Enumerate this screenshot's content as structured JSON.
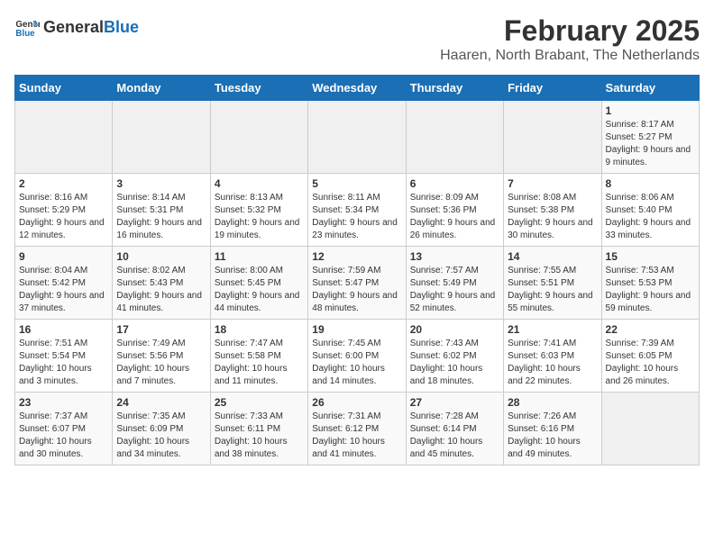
{
  "header": {
    "logo_general": "General",
    "logo_blue": "Blue",
    "month_year": "February 2025",
    "location": "Haaren, North Brabant, The Netherlands"
  },
  "weekdays": [
    "Sunday",
    "Monday",
    "Tuesday",
    "Wednesday",
    "Thursday",
    "Friday",
    "Saturday"
  ],
  "weeks": [
    [
      {
        "day": "",
        "info": ""
      },
      {
        "day": "",
        "info": ""
      },
      {
        "day": "",
        "info": ""
      },
      {
        "day": "",
        "info": ""
      },
      {
        "day": "",
        "info": ""
      },
      {
        "day": "",
        "info": ""
      },
      {
        "day": "1",
        "info": "Sunrise: 8:17 AM\nSunset: 5:27 PM\nDaylight: 9 hours and 9 minutes."
      }
    ],
    [
      {
        "day": "2",
        "info": "Sunrise: 8:16 AM\nSunset: 5:29 PM\nDaylight: 9 hours and 12 minutes."
      },
      {
        "day": "3",
        "info": "Sunrise: 8:14 AM\nSunset: 5:31 PM\nDaylight: 9 hours and 16 minutes."
      },
      {
        "day": "4",
        "info": "Sunrise: 8:13 AM\nSunset: 5:32 PM\nDaylight: 9 hours and 19 minutes."
      },
      {
        "day": "5",
        "info": "Sunrise: 8:11 AM\nSunset: 5:34 PM\nDaylight: 9 hours and 23 minutes."
      },
      {
        "day": "6",
        "info": "Sunrise: 8:09 AM\nSunset: 5:36 PM\nDaylight: 9 hours and 26 minutes."
      },
      {
        "day": "7",
        "info": "Sunrise: 8:08 AM\nSunset: 5:38 PM\nDaylight: 9 hours and 30 minutes."
      },
      {
        "day": "8",
        "info": "Sunrise: 8:06 AM\nSunset: 5:40 PM\nDaylight: 9 hours and 33 minutes."
      }
    ],
    [
      {
        "day": "9",
        "info": "Sunrise: 8:04 AM\nSunset: 5:42 PM\nDaylight: 9 hours and 37 minutes."
      },
      {
        "day": "10",
        "info": "Sunrise: 8:02 AM\nSunset: 5:43 PM\nDaylight: 9 hours and 41 minutes."
      },
      {
        "day": "11",
        "info": "Sunrise: 8:00 AM\nSunset: 5:45 PM\nDaylight: 9 hours and 44 minutes."
      },
      {
        "day": "12",
        "info": "Sunrise: 7:59 AM\nSunset: 5:47 PM\nDaylight: 9 hours and 48 minutes."
      },
      {
        "day": "13",
        "info": "Sunrise: 7:57 AM\nSunset: 5:49 PM\nDaylight: 9 hours and 52 minutes."
      },
      {
        "day": "14",
        "info": "Sunrise: 7:55 AM\nSunset: 5:51 PM\nDaylight: 9 hours and 55 minutes."
      },
      {
        "day": "15",
        "info": "Sunrise: 7:53 AM\nSunset: 5:53 PM\nDaylight: 9 hours and 59 minutes."
      }
    ],
    [
      {
        "day": "16",
        "info": "Sunrise: 7:51 AM\nSunset: 5:54 PM\nDaylight: 10 hours and 3 minutes."
      },
      {
        "day": "17",
        "info": "Sunrise: 7:49 AM\nSunset: 5:56 PM\nDaylight: 10 hours and 7 minutes."
      },
      {
        "day": "18",
        "info": "Sunrise: 7:47 AM\nSunset: 5:58 PM\nDaylight: 10 hours and 11 minutes."
      },
      {
        "day": "19",
        "info": "Sunrise: 7:45 AM\nSunset: 6:00 PM\nDaylight: 10 hours and 14 minutes."
      },
      {
        "day": "20",
        "info": "Sunrise: 7:43 AM\nSunset: 6:02 PM\nDaylight: 10 hours and 18 minutes."
      },
      {
        "day": "21",
        "info": "Sunrise: 7:41 AM\nSunset: 6:03 PM\nDaylight: 10 hours and 22 minutes."
      },
      {
        "day": "22",
        "info": "Sunrise: 7:39 AM\nSunset: 6:05 PM\nDaylight: 10 hours and 26 minutes."
      }
    ],
    [
      {
        "day": "23",
        "info": "Sunrise: 7:37 AM\nSunset: 6:07 PM\nDaylight: 10 hours and 30 minutes."
      },
      {
        "day": "24",
        "info": "Sunrise: 7:35 AM\nSunset: 6:09 PM\nDaylight: 10 hours and 34 minutes."
      },
      {
        "day": "25",
        "info": "Sunrise: 7:33 AM\nSunset: 6:11 PM\nDaylight: 10 hours and 38 minutes."
      },
      {
        "day": "26",
        "info": "Sunrise: 7:31 AM\nSunset: 6:12 PM\nDaylight: 10 hours and 41 minutes."
      },
      {
        "day": "27",
        "info": "Sunrise: 7:28 AM\nSunset: 6:14 PM\nDaylight: 10 hours and 45 minutes."
      },
      {
        "day": "28",
        "info": "Sunrise: 7:26 AM\nSunset: 6:16 PM\nDaylight: 10 hours and 49 minutes."
      },
      {
        "day": "",
        "info": ""
      }
    ]
  ]
}
